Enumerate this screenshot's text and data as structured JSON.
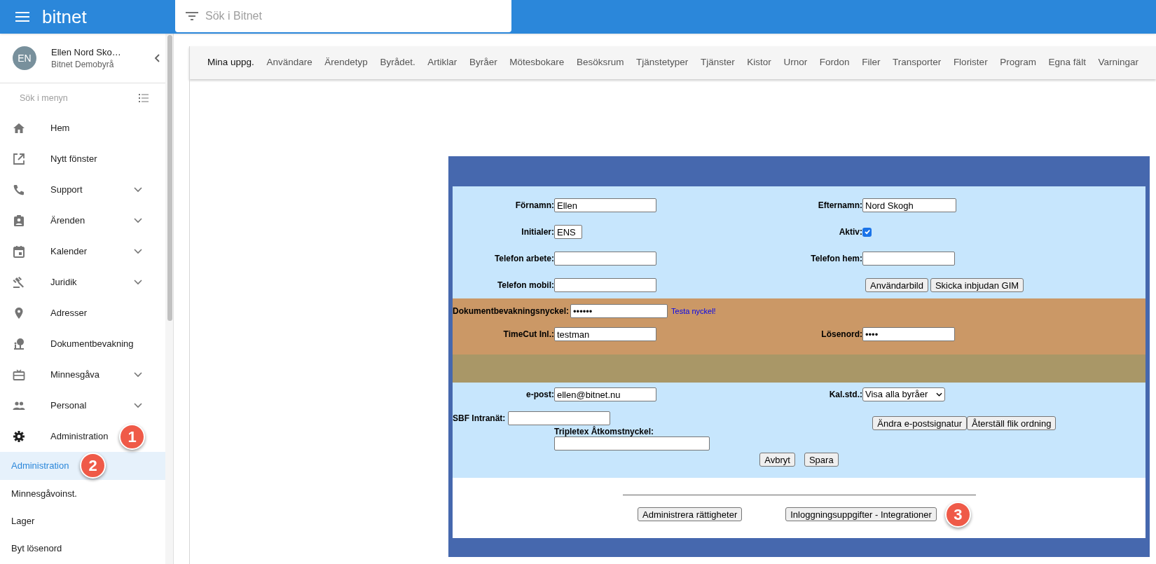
{
  "app": {
    "title": "bitnet"
  },
  "search": {
    "placeholder": "Sök i Bitnet"
  },
  "user": {
    "initials": "EN",
    "name": "Ellen Nord Sko…",
    "org": "Bitnet Demobyrå"
  },
  "menu_search": {
    "placeholder": "Sök i menyn"
  },
  "menu": [
    {
      "label": "Hem",
      "kind": "link"
    },
    {
      "label": "Nytt fönster",
      "kind": "link"
    },
    {
      "label": "Support",
      "kind": "group",
      "expanded": false
    },
    {
      "label": "Ärenden",
      "kind": "group",
      "expanded": false
    },
    {
      "label": "Kalender",
      "kind": "group",
      "expanded": false
    },
    {
      "label": "Juridik",
      "kind": "group",
      "expanded": false
    },
    {
      "label": "Adresser",
      "kind": "link"
    },
    {
      "label": "Dokumentbevakning",
      "kind": "link"
    },
    {
      "label": "Minnesgåva",
      "kind": "group",
      "expanded": false
    },
    {
      "label": "Personal",
      "kind": "group",
      "expanded": false
    },
    {
      "label": "Administration",
      "kind": "group",
      "expanded": true,
      "callout": "1",
      "children": [
        {
          "label": "Administration",
          "selected": true,
          "callout": "2"
        },
        {
          "label": "Minnesgåvoinst.",
          "selected": false
        },
        {
          "label": "Lager",
          "selected": false
        },
        {
          "label": "Byt lösenord",
          "selected": false
        }
      ]
    }
  ],
  "tabs": [
    {
      "label": "Mina uppg.",
      "selected": true
    },
    {
      "label": "Användare",
      "selected": false
    },
    {
      "label": "Ärendetyp",
      "selected": false
    },
    {
      "label": "Byrådet.",
      "selected": false
    },
    {
      "label": "Artiklar",
      "selected": false
    },
    {
      "label": "Byråer",
      "selected": false
    },
    {
      "label": "Mötesbokare",
      "selected": false
    },
    {
      "label": "Besöksrum",
      "selected": false
    },
    {
      "label": "Tjänstetyper",
      "selected": false
    },
    {
      "label": "Tjänster",
      "selected": false
    },
    {
      "label": "Kistor",
      "selected": false
    },
    {
      "label": "Urnor",
      "selected": false
    },
    {
      "label": "Fordon",
      "selected": false
    },
    {
      "label": "Filer",
      "selected": false
    },
    {
      "label": "Transporter",
      "selected": false
    },
    {
      "label": "Florister",
      "selected": false
    },
    {
      "label": "Program",
      "selected": false
    },
    {
      "label": "Egna fält",
      "selected": false
    },
    {
      "label": "Varningar",
      "selected": false
    }
  ],
  "form": {
    "first_name": {
      "label": "Förnamn:",
      "value": "Ellen"
    },
    "last_name": {
      "label": "Efternamn:",
      "value": "Nord Skogh"
    },
    "initials": {
      "label": "Initialer:",
      "value": "ENS"
    },
    "active": {
      "label": "Aktiv:",
      "checked": true
    },
    "phone_work": {
      "label": "Telefon arbete:"
    },
    "phone_home": {
      "label": "Telefon hem:"
    },
    "phone_mobile": {
      "label": "Telefon mobil:"
    },
    "profile_buttons": [
      "Användarbild",
      "Skicka inbjudan GIM"
    ],
    "document_key": {
      "label": "Dokumentbevakningsnyckel:",
      "value": "••••••"
    },
    "test_key_link": "Testa nyckel!",
    "timecut": {
      "label": "TimeCut Inl.:",
      "value": "testman"
    },
    "password": {
      "label": "Lösenord:",
      "value": "••••"
    },
    "email": {
      "label": "e-post:",
      "value": "ellen@bitnet.nu"
    },
    "calendar": {
      "label": "Kal.std.:",
      "value": "Visa alla byråer"
    },
    "sbf_intranet": {
      "label": "SBF Intranät:"
    },
    "mail_buttons": [
      "Ändra e-postsignatur",
      "Återställ flik ordning"
    ],
    "tripletex": {
      "label": "Tripletex Åtkomstnyckel:"
    },
    "actions": [
      "Avbryt",
      "Spara"
    ]
  },
  "footer_buttons": [
    {
      "label": "Administrera rättigheter"
    },
    {
      "label": "Inloggningsuppgifter - Integrationer",
      "callout": "3"
    }
  ]
}
